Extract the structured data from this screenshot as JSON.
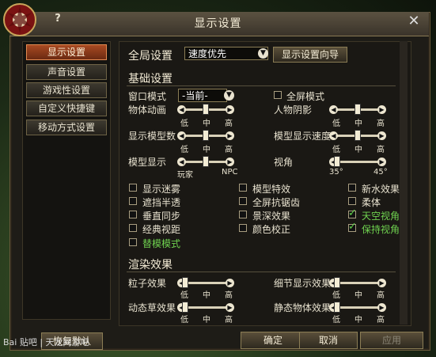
{
  "window": {
    "title": "显示设置",
    "help": "?",
    "close": "✕"
  },
  "sidebar": {
    "items": [
      {
        "label": "显示设置",
        "active": true
      },
      {
        "label": "声音设置",
        "active": false
      },
      {
        "label": "游戏性设置",
        "active": false
      },
      {
        "label": "自定义快捷键",
        "active": false
      },
      {
        "label": "移动方式设置",
        "active": false
      }
    ]
  },
  "global": {
    "label": "全局设置",
    "preset_value": "速度优先",
    "wizard_button": "显示设置向导"
  },
  "basic": {
    "heading": "基础设置",
    "window_mode_label": "窗口模式",
    "window_mode_value": "-当前-",
    "fullscreen_label": "全屏模式",
    "sliders": [
      {
        "label": "物体动画",
        "ticks": [
          "低",
          "中",
          "高"
        ],
        "value": 0.5
      },
      {
        "label": "人物阴影",
        "ticks": [
          "低",
          "中",
          "高"
        ],
        "value": 0.5
      },
      {
        "label": "显示模型数",
        "ticks": [
          "低",
          "中",
          "高"
        ],
        "value": 0.5
      },
      {
        "label": "模型显示速度",
        "ticks": [
          "低",
          "中",
          "高"
        ],
        "value": 0.5
      },
      {
        "label": "模型显示",
        "ticks": [
          "玩家",
          "NPC"
        ],
        "value": 0.5
      },
      {
        "label": "视角",
        "ticks": [
          "35°",
          "45°"
        ],
        "value": 0.0
      }
    ],
    "checkboxes": [
      {
        "label": "显示迷雾",
        "checked": false
      },
      {
        "label": "模型特效",
        "checked": false
      },
      {
        "label": "新水效果",
        "checked": false
      },
      {
        "label": "遮挡半透",
        "checked": false
      },
      {
        "label": "全屏抗锯齿",
        "checked": false
      },
      {
        "label": "柔体",
        "checked": false
      },
      {
        "label": "垂直同步",
        "checked": false
      },
      {
        "label": "景深效果",
        "checked": false
      },
      {
        "label": "天空视角",
        "checked": true
      },
      {
        "label": "经典视距",
        "checked": false
      },
      {
        "label": "颜色校正",
        "checked": false
      },
      {
        "label": "保持视角",
        "checked": true
      },
      {
        "label": "替模模式",
        "checked": false
      }
    ]
  },
  "render": {
    "heading": "渲染效果",
    "sliders": [
      {
        "label": "粒子效果",
        "ticks": [
          "低",
          "中",
          "高"
        ],
        "value": 0.0
      },
      {
        "label": "细节显示效果",
        "ticks": [
          "低",
          "中",
          "高"
        ],
        "value": 0.0
      },
      {
        "label": "动态草效果",
        "ticks": [
          "低",
          "中",
          "高"
        ],
        "value": 0.0
      },
      {
        "label": "静态物体效果",
        "ticks": [
          "低",
          "中",
          "高"
        ],
        "value": 0.0
      }
    ]
  },
  "footer": {
    "restore": "恢复默认",
    "ok": "确定",
    "cancel": "取消",
    "apply": "应用"
  },
  "watermark": "Bai 贴吧 | 天龙网游吧",
  "colors": {
    "accent": "#a84a22",
    "checked": "#6fd24f"
  }
}
